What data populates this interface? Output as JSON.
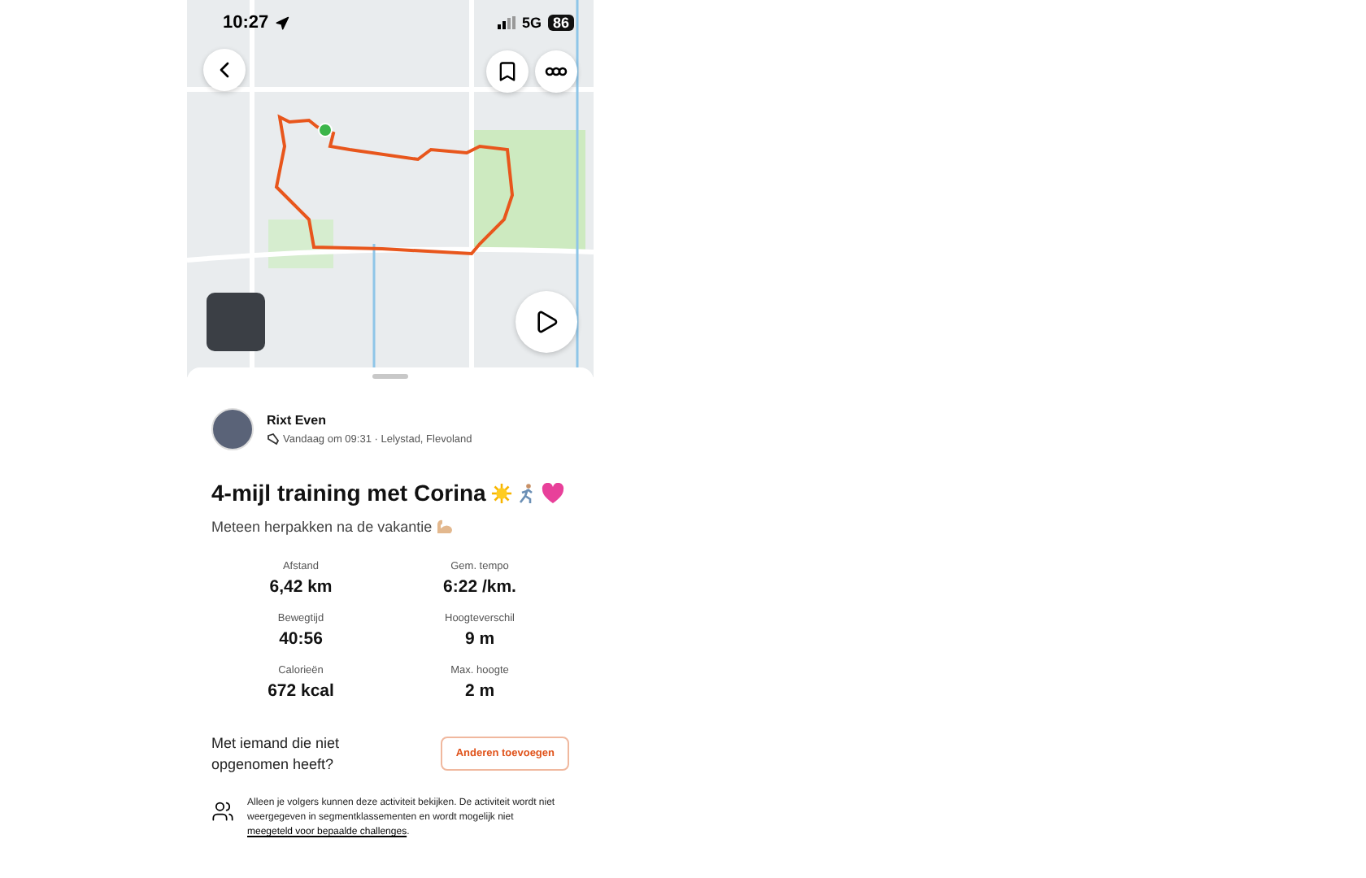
{
  "status_bar": {
    "time": "10:27",
    "network": "5G",
    "battery": "86"
  },
  "activity": {
    "athlete": "Rixt Even",
    "meta": "Vandaag om 09:31 · Lelystad, Flevoland",
    "title": "4-mijl training met Corina",
    "title_emoji": [
      {
        "kind": "sun"
      },
      {
        "kind": "runner"
      },
      {
        "kind": "heart"
      }
    ],
    "description": "Meteen herpakken na de vakantie",
    "description_emoji": [
      {
        "kind": "muscle"
      }
    ]
  },
  "stats": [
    {
      "label": "Afstand",
      "value": "6,42 km"
    },
    {
      "label": "Gem. tempo",
      "value": "6:22 /km."
    },
    {
      "label": "Bewegtijd",
      "value": "40:56"
    },
    {
      "label": "Hoogteverschil",
      "value": "9 m"
    },
    {
      "label": "Calorieën",
      "value": "672 kcal"
    },
    {
      "label": "Max. hoogte",
      "value": "2 m"
    }
  ],
  "add_others": {
    "question": "Met iemand die niet opgenomen heeft?",
    "button": "Anderen toevoegen"
  },
  "privacy": {
    "text": "Alleen je volgers kunnen deze activiteit bekijken. De activiteit wordt niet weergegeven in segmentklassementen en wordt mogelijk niet ",
    "link": "meegeteld voor bepaalde challenges",
    "end": "."
  }
}
